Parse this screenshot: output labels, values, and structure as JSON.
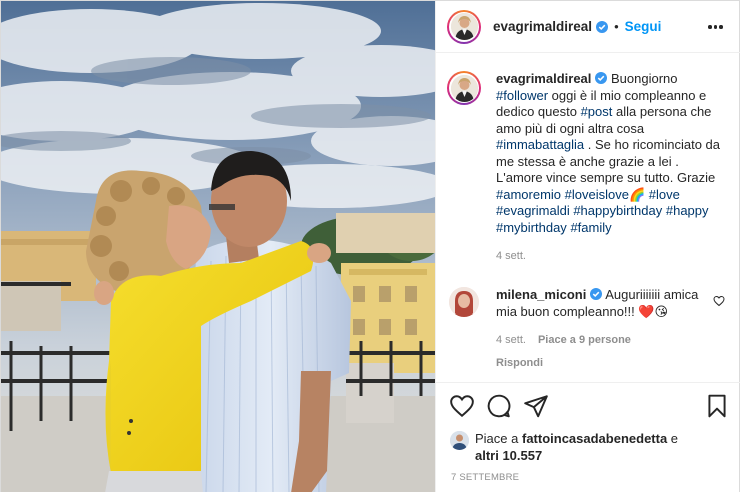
{
  "post": {
    "username": "evagrimaldireal",
    "follow_label": "Segui",
    "separator": "•"
  },
  "caption": {
    "username": "evagrimaldireal",
    "parts": [
      {
        "t": " Buongiorno ",
        "h": false
      },
      {
        "t": "#follower",
        "h": true
      },
      {
        "t": " oggi è il mio compleanno e dedico questo ",
        "h": false
      },
      {
        "t": "#post",
        "h": true
      },
      {
        "t": " alla persona che amo più di ogni altra cosa ",
        "h": false
      },
      {
        "t": "#immabattaglia",
        "h": true
      },
      {
        "t": " . Se ho ricominciato da me stessa è anche grazie a lei . L'amore vince sempre su tutto. Grazie ",
        "h": false
      },
      {
        "t": "#amoremio",
        "h": true
      },
      {
        "t": " ",
        "h": false
      },
      {
        "t": "#loveislove",
        "h": true
      },
      {
        "t": "🌈",
        "h": false
      },
      {
        "t": " ",
        "h": false
      },
      {
        "t": "#love",
        "h": true
      },
      {
        "t": " ",
        "h": false
      },
      {
        "t": "#evagrimaldi",
        "h": true
      },
      {
        "t": " ",
        "h": false
      },
      {
        "t": "#happybirthday",
        "h": true
      },
      {
        "t": " ",
        "h": false
      },
      {
        "t": "#happy",
        "h": true
      },
      {
        "t": " ",
        "h": false
      },
      {
        "t": "#mybirthday",
        "h": true
      },
      {
        "t": " ",
        "h": false
      },
      {
        "t": "#family",
        "h": true
      }
    ],
    "time": "4 sett."
  },
  "comment": {
    "username": "milena_miconi",
    "text": " Auguriiiiiii amica mia buon compleanno!!! ❤️😘",
    "time": "4 sett.",
    "likes": "Piace a 9 persone",
    "reply": "Rispondi"
  },
  "likes": {
    "prefix": "Piace a ",
    "user": "fattoincasadabenedetta",
    "middle": " e ",
    "others": "altri 10.557"
  },
  "date": "7 SETTEMBRE",
  "colors": {
    "accent": "#0095f6",
    "hashtag": "#00376b",
    "muted": "#8e8e8e",
    "text": "#262626",
    "verified": "#3897f0",
    "jacket": "#f2d21a"
  }
}
